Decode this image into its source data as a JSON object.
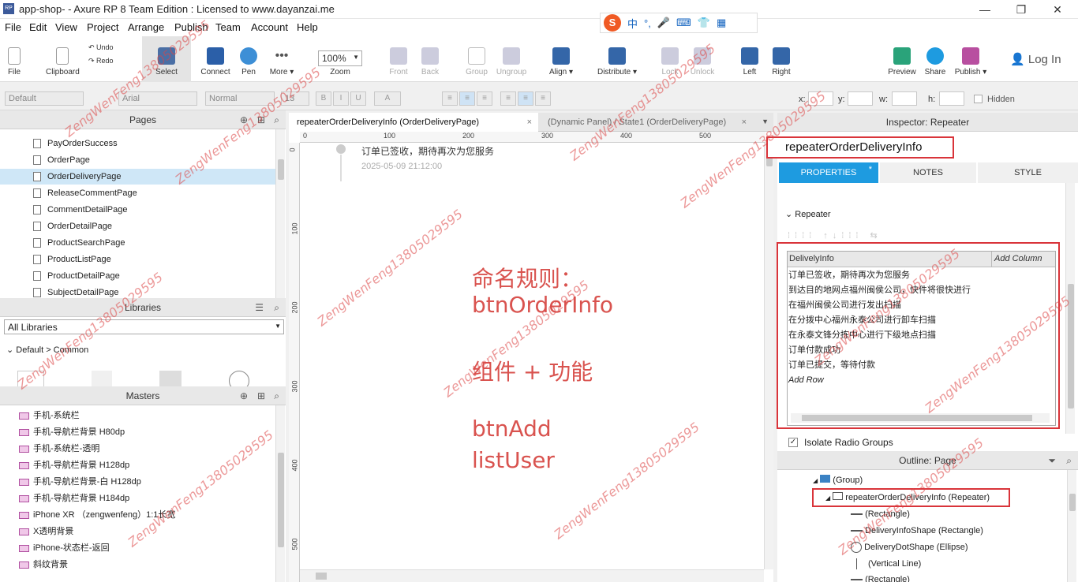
{
  "window": {
    "title": "app-shop- - Axure RP 8 Team Edition : Licensed to www.dayanzai.me",
    "logo": "RP",
    "minimize": "—",
    "restore": "❐",
    "close": "✕"
  },
  "menu": [
    "File",
    "Edit",
    "View",
    "Project",
    "Arrange",
    "Publish",
    "Team",
    "Account",
    "Help"
  ],
  "ime": {
    "logo": "S",
    "mode": "中",
    "punct": "°,"
  },
  "toolbar": {
    "file": "File",
    "clipboard": "Clipboard",
    "undo": "Undo",
    "redo": "Redo",
    "select": "Select",
    "connect": "Connect",
    "pen": "Pen",
    "more": "More ▾",
    "zoom_value": "100%",
    "zoom": "Zoom",
    "front": "Front",
    "back": "Back",
    "group": "Group",
    "ungroup": "Ungroup",
    "align": "Align ▾",
    "distribute": "Distribute ▾",
    "lock": "Lock",
    "unlock": "Unlock",
    "left": "Left",
    "right": "Right",
    "preview": "Preview",
    "share": "Share",
    "publish": "Publish ▾",
    "login": "Log In"
  },
  "format": {
    "style": "Default",
    "font": "Arial",
    "weight": "Normal",
    "size": "13",
    "x": "x:",
    "y": "y:",
    "w": "w:",
    "h": "h:",
    "hidden": "Hidden",
    "bold": "B",
    "italic": "I",
    "underline": "U",
    "text_color": "A"
  },
  "pages": {
    "title": "Pages",
    "items": [
      "PayOrderSuccess",
      "OrderPage",
      "OrderDeliveryPage",
      "ReleaseCommentPage",
      "CommentDetailPage",
      "OrderDetailPage",
      "ProductSearchPage",
      "ProductListPage",
      "ProductDetailPage",
      "SubjectDetailPage"
    ],
    "selected": "OrderDeliveryPage"
  },
  "libraries": {
    "title": "Libraries",
    "selected": "All Libraries",
    "group": "Default > Common"
  },
  "masters": {
    "title": "Masters",
    "items": [
      "手机-系统栏",
      "手机-导航栏背景 H80dp",
      "手机-系统栏-透明",
      "手机-导航栏背景 H128dp",
      "手机-导航栏背景-白 H128dp",
      "手机-导航栏背景 H184dp",
      "iPhone XR （zengwenfeng）1:1长宽",
      "X透明背景",
      "iPhone-状态栏-返回",
      "斜纹背景"
    ]
  },
  "tabs": [
    {
      "label": "repeaterOrderDeliveryInfo (OrderDeliveryPage)",
      "close": "×"
    },
    {
      "label": "(Dynamic Panel) / State1 (OrderDeliveryPage)",
      "close": "×"
    }
  ],
  "canvas": {
    "ruler_h": [
      "0",
      "100",
      "200",
      "300",
      "400",
      "500"
    ],
    "ruler_v": [
      "0",
      "100",
      "200",
      "300",
      "400",
      "500"
    ],
    "item_title": "订单已签收，期待再次为您服务",
    "item_time": "2025-05-09 21:12:00",
    "annotations": [
      "命名规则：",
      "btnOrderInfo",
      "组件 + 功能",
      "btnAdd",
      "listUser"
    ]
  },
  "inspector": {
    "title": "Inspector: Repeater",
    "name": "repeaterOrderDeliveryInfo",
    "tabs": [
      "PROPERTIES",
      "NOTES",
      "STYLE"
    ],
    "properties_mark": "*",
    "section": "Repeater",
    "column": "DelivelyInfo",
    "add_column": "Add Column",
    "rows": [
      "订单已签收，期待再次为您服务",
      "到达目的地网点福州闽侯公司，快件将很快进行",
      " 在福州闽侯公司进行发出扫描",
      " 在分拨中心福州永泰公司进行卸车扫描",
      " 在永泰文锋分拣中心进行下级地点扫描",
      "订单付款成功",
      "订单已提交，等待付款"
    ],
    "add_row": "Add Row",
    "isolate": "Isolate Radio Groups"
  },
  "outline": {
    "title": "Outline: Page",
    "items": [
      {
        "label": "(Group)",
        "indent": 1
      },
      {
        "label": "repeaterOrderDeliveryInfo (Repeater)",
        "indent": 2
      },
      {
        "label": "(Rectangle)",
        "indent": 3
      },
      {
        "label": "DeliveryInfoShape (Rectangle)",
        "indent": 3
      },
      {
        "label": "DeliveryDotShape (Ellipse)",
        "indent": 3
      },
      {
        "label": "(Vertical Line)",
        "indent": 3
      },
      {
        "label": "(Rectangle)",
        "indent": 3
      }
    ]
  },
  "watermark": "ZengWenFeng13805029595",
  "colors": {
    "accent": "#1e9be0",
    "annotation": "#d9534f",
    "highlight": "#d9343a"
  }
}
